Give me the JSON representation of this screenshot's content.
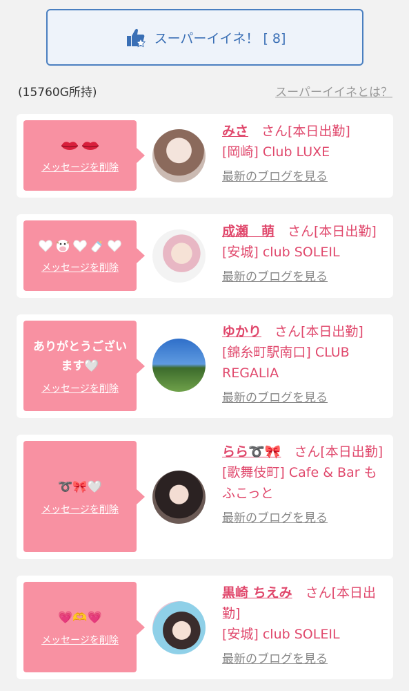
{
  "super_button": {
    "label": "スーパーイイネ！ [ 8]"
  },
  "points": "(15760G所持)",
  "about_link": "スーパーイイネとは？",
  "delete_label": "メッセージを削除",
  "blog_label": "最新のブログを見る",
  "cards": [
    {
      "name": "みさ",
      "suffix": "　さん[本日出勤]",
      "store": "[岡崎] Club LUXE",
      "message": ""
    },
    {
      "name": "成瀬　萌",
      "suffix": "　さん[本日出勤]",
      "store": "[安城] club SOLEIL",
      "message": ""
    },
    {
      "name": "ゆかり",
      "suffix": "　さん[本日出勤]",
      "store": "[錦糸町駅南口] CLUB REGALIA",
      "message": "ありがとうございます🤍"
    },
    {
      "name": "らら➰🎀",
      "suffix": "　さん[本日出勤]",
      "store": "[歌舞伎町] Cafe & Bar もふこっと",
      "message": "➰🎀🤍"
    },
    {
      "name": "黒崎 ちえみ",
      "suffix": "　さん[本日出勤]",
      "store": "[安城] club SOLEIL",
      "message": "💗🫶💗"
    }
  ]
}
